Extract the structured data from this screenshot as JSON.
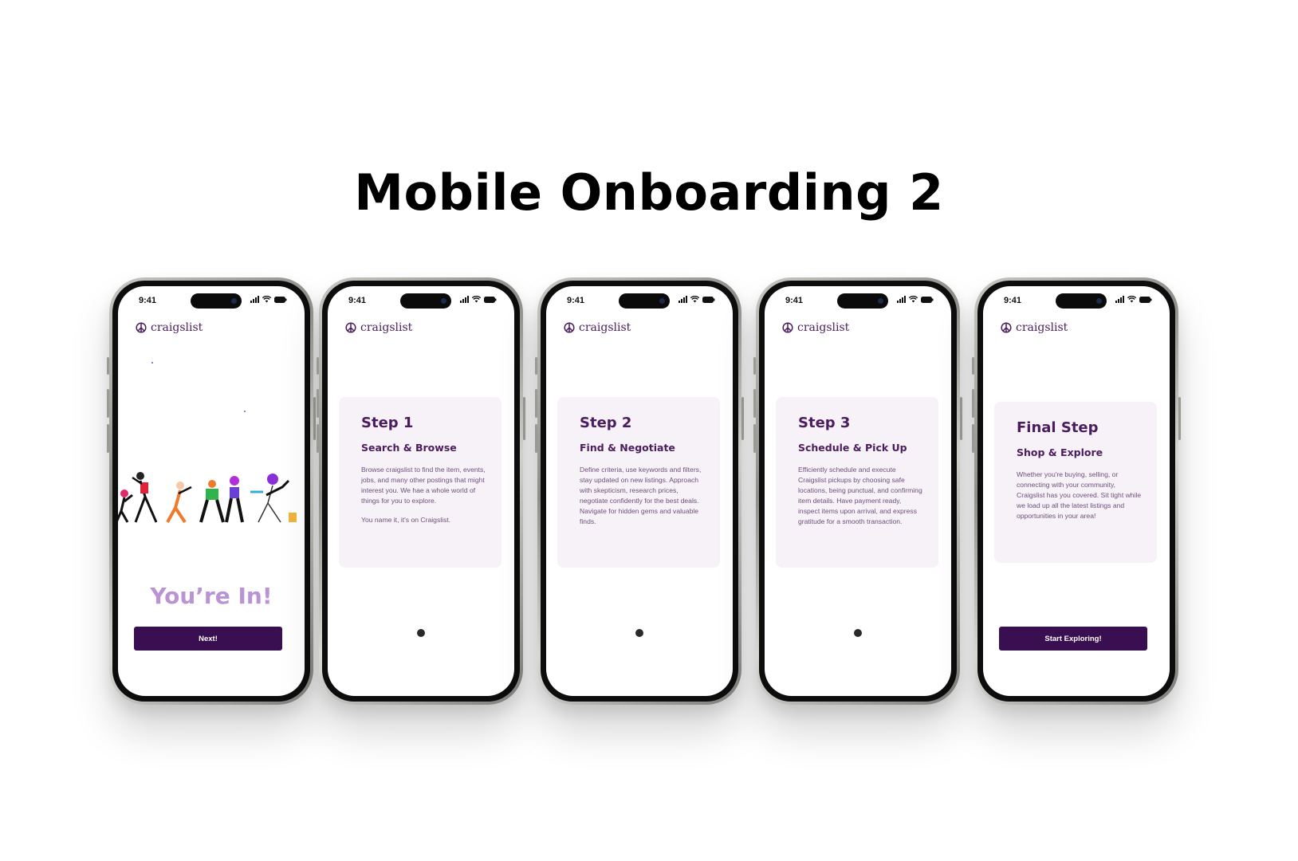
{
  "page": {
    "title": "Mobile Onboarding 2"
  },
  "status": {
    "time": "9:41"
  },
  "brand": {
    "name": "craigslist"
  },
  "screens": [
    {
      "id": "welcome",
      "hero_title": "You’re In!",
      "button_label": "Next!"
    },
    {
      "id": "step1",
      "step": "Step 1",
      "subtitle": "Search & Browse",
      "body": "Browse craigslist to find the item, events, jobs, and many other postings that might interest you. We hae a whole world of things for you to explore.",
      "extra": "You name it, it's on Craigslist."
    },
    {
      "id": "step2",
      "step": "Step 2",
      "subtitle": "Find & Negotiate",
      "body": "Define criteria, use keywords and filters, stay updated on new listings. Approach with skepticism, research prices, negotiate confidently for the best deals. Navigate for hidden gems and valuable finds."
    },
    {
      "id": "step3",
      "step": "Step 3",
      "subtitle": "Schedule & Pick Up",
      "body": "Efficiently schedule and execute Craigslist pickups by choosing safe locations, being punctual, and confirming item details. Have payment ready, inspect items upon arrival, and express gratitude for a smooth transaction."
    },
    {
      "id": "final",
      "step": "Final Step",
      "subtitle": "Shop & Explore",
      "body": "Whether you're buying, selling, or connecting with your community, Craigslist has you covered. Sit tight while we load up all the latest listings and opportunities in your area!",
      "button_label": "Start Exploring!"
    }
  ],
  "colors": {
    "brand": "#4b1c5e",
    "button": "#3a0f52",
    "hero": "#b993d6",
    "card": "#f6f2f7"
  },
  "icons": [
    "peace-sign-icon",
    "signal-icon",
    "wifi-icon",
    "battery-icon"
  ]
}
